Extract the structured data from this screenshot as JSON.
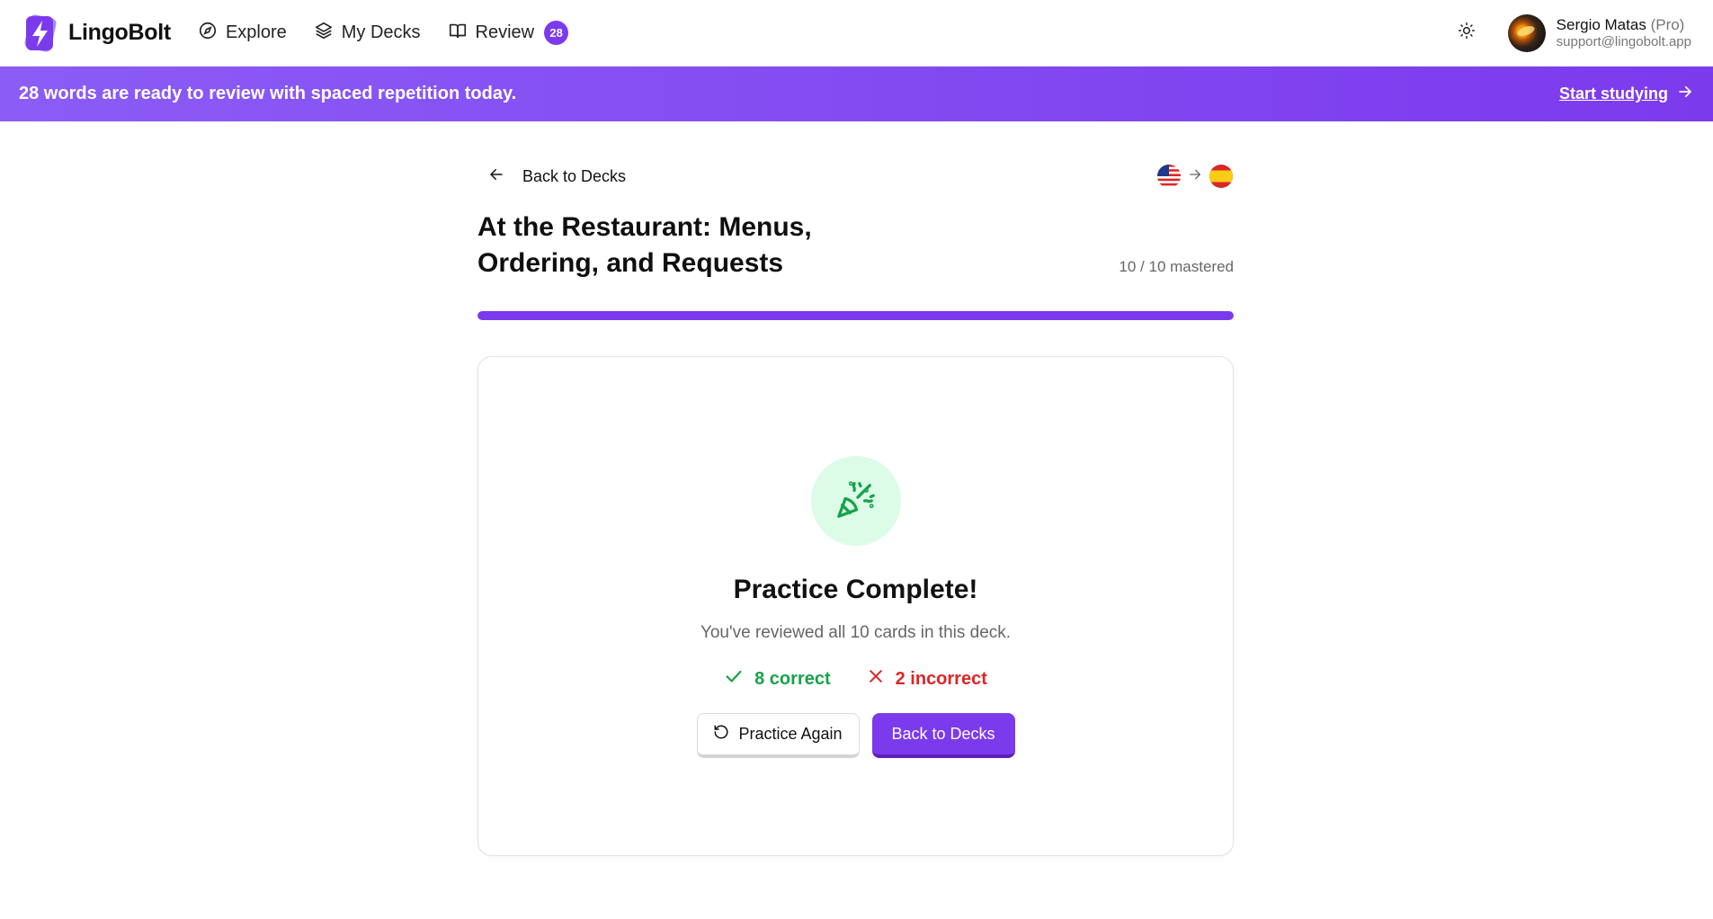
{
  "app": {
    "name": "LingoBolt"
  },
  "nav": {
    "items": [
      {
        "label": "Explore",
        "icon": "compass-icon"
      },
      {
        "label": "My Decks",
        "icon": "layers-icon"
      },
      {
        "label": "Review",
        "icon": "book-open-icon",
        "badge": "28"
      }
    ]
  },
  "user": {
    "name": "Sergio Matas",
    "plan": "(Pro)",
    "email": "support@lingobolt.app"
  },
  "banner": {
    "text": "28 words are ready to review with spaced repetition today.",
    "cta": "Start studying"
  },
  "deck": {
    "back_label": "Back to Decks",
    "from_flag": "us-flag-icon",
    "to_flag": "spain-flag-icon",
    "title": "At the Restaurant: Menus, Ordering, and Requests",
    "mastered_text": "10 / 10 mastered",
    "progress": 1.0
  },
  "result": {
    "icon": "party-popper-icon",
    "title": "Practice Complete!",
    "subtitle": "You've reviewed all 10 cards in this deck.",
    "correct_text": "8 correct",
    "incorrect_text": "2 incorrect",
    "practice_again_label": "Practice Again",
    "back_label": "Back to Decks"
  },
  "colors": {
    "accent": "#7c3aed",
    "success": "#16a34a",
    "danger": "#dc2626",
    "success_bg": "#dcfce7"
  }
}
